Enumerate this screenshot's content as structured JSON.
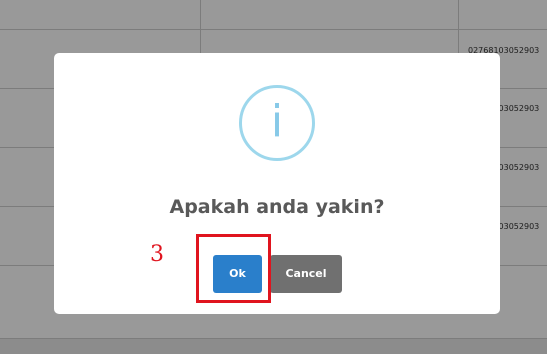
{
  "background_table": {
    "rows": [
      {
        "last_cell": ""
      },
      {
        "last_cell": "02768103052903"
      },
      {
        "last_cell": "02768103052903"
      },
      {
        "last_cell": "02768103052903"
      },
      {
        "last_cell": "02768103052903"
      }
    ]
  },
  "dialog": {
    "icon": "info-icon",
    "icon_glyph": "i",
    "title": "Apakah anda yakin?",
    "ok_label": "Ok",
    "cancel_label": "Cancel"
  },
  "annotation": {
    "number": "3",
    "color": "#e0141e"
  },
  "colors": {
    "ok_button": "#2a7fcb",
    "cancel_button": "#707070",
    "info_icon": "#9dd7ec"
  }
}
